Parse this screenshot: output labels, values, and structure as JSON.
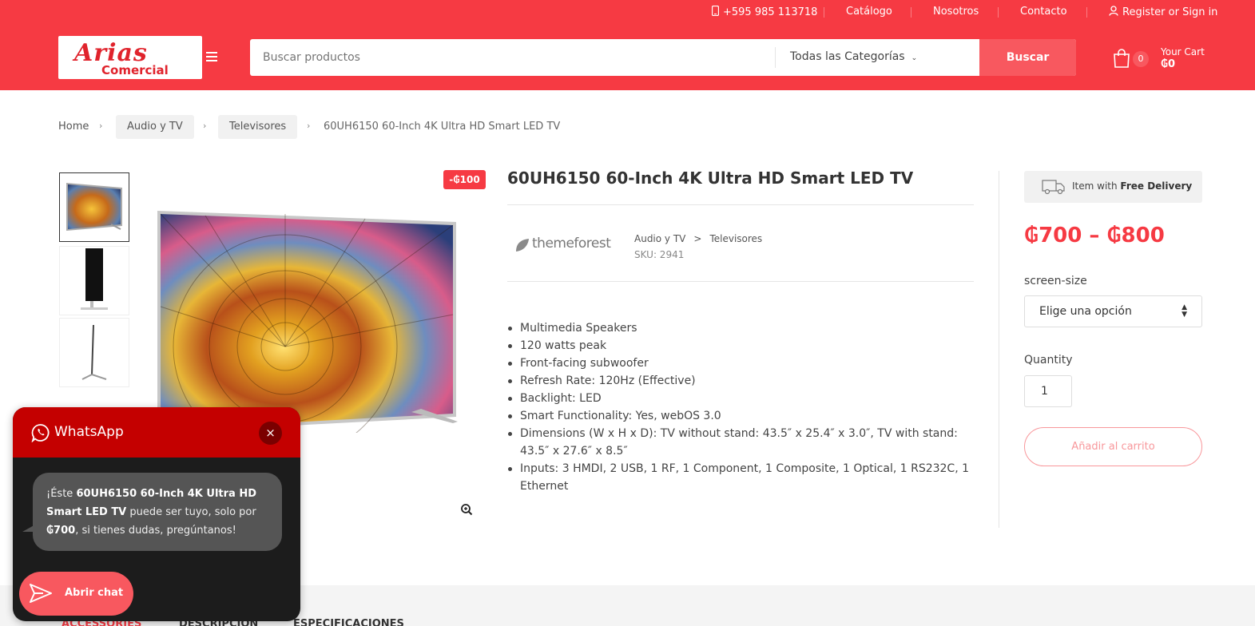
{
  "topbar": {
    "phone": "+595 985 113718",
    "catalog": "Catálogo",
    "about": "Nosotros",
    "contact": "Contacto",
    "account": "Register or Sign in"
  },
  "header": {
    "logo_line1": "Arias",
    "logo_line2": "Comercial",
    "search_placeholder": "Buscar productos",
    "category_select": "Todas las Categorías",
    "search_button": "Buscar",
    "cart_count": "0",
    "cart_label": "Your Cart",
    "cart_amount": "₲0"
  },
  "breadcrumb": {
    "home": "Home",
    "level1": "Audio y TV",
    "level2": "Televisores",
    "current": "60UH6150 60-Inch 4K Ultra HD Smart LED TV",
    "separator": "›"
  },
  "product": {
    "sale_badge": "-₲100",
    "title": "60UH6150 60-Inch 4K Ultra HD Smart LED TV",
    "brand": "themeforest",
    "category1": "Audio y TV",
    "category_sep": ">",
    "category2": "Televisores",
    "sku": "SKU: 2941",
    "features": [
      "Multimedia Speakers",
      "120 watts peak",
      "Front-facing subwoofer",
      "Refresh Rate: 120Hz (Effective)",
      "Backlight: LED",
      "Smart Functionality: Yes, webOS 3.0",
      "Dimensions (W x H x D): TV without stand: 43.5″ x 25.4″ x 3.0″, TV with stand: 43.5″ x 27.6″ x 8.5″",
      "Inputs: 3 HMDI, 2 USB, 1 RF, 1 Component, 1 Composite, 1 Optical, 1 RS232C, 1 Ethernet"
    ]
  },
  "purchase": {
    "delivery_prefix": "Item with ",
    "delivery_bold": "Free Delivery",
    "price_range": "₲700 – ₲800",
    "option_label": "screen-size",
    "option_value": "Elige una opción",
    "quantity_label": "Quantity",
    "quantity_value": "1",
    "add_to_cart": "Añadir al carrito"
  },
  "tabs": [
    "ACCESSORIES",
    "DESCRIPCION",
    "ESPECIFICACIONES"
  ],
  "whatsapp": {
    "title": "WhatsApp",
    "close": "×",
    "msg_pre": "¡Éste ",
    "msg_product": "60UH6150 60-Inch 4K Ultra HD Smart LED TV",
    "msg_mid": " puede ser tuyo, solo por ",
    "msg_price": "₲700",
    "msg_post": ", si tienes dudas, pregúntanos!",
    "button": "Abrir chat"
  },
  "colors": {
    "brand_red": "#f63a43",
    "button_red": "#f8585f",
    "whatsapp_header": "#c40000"
  }
}
